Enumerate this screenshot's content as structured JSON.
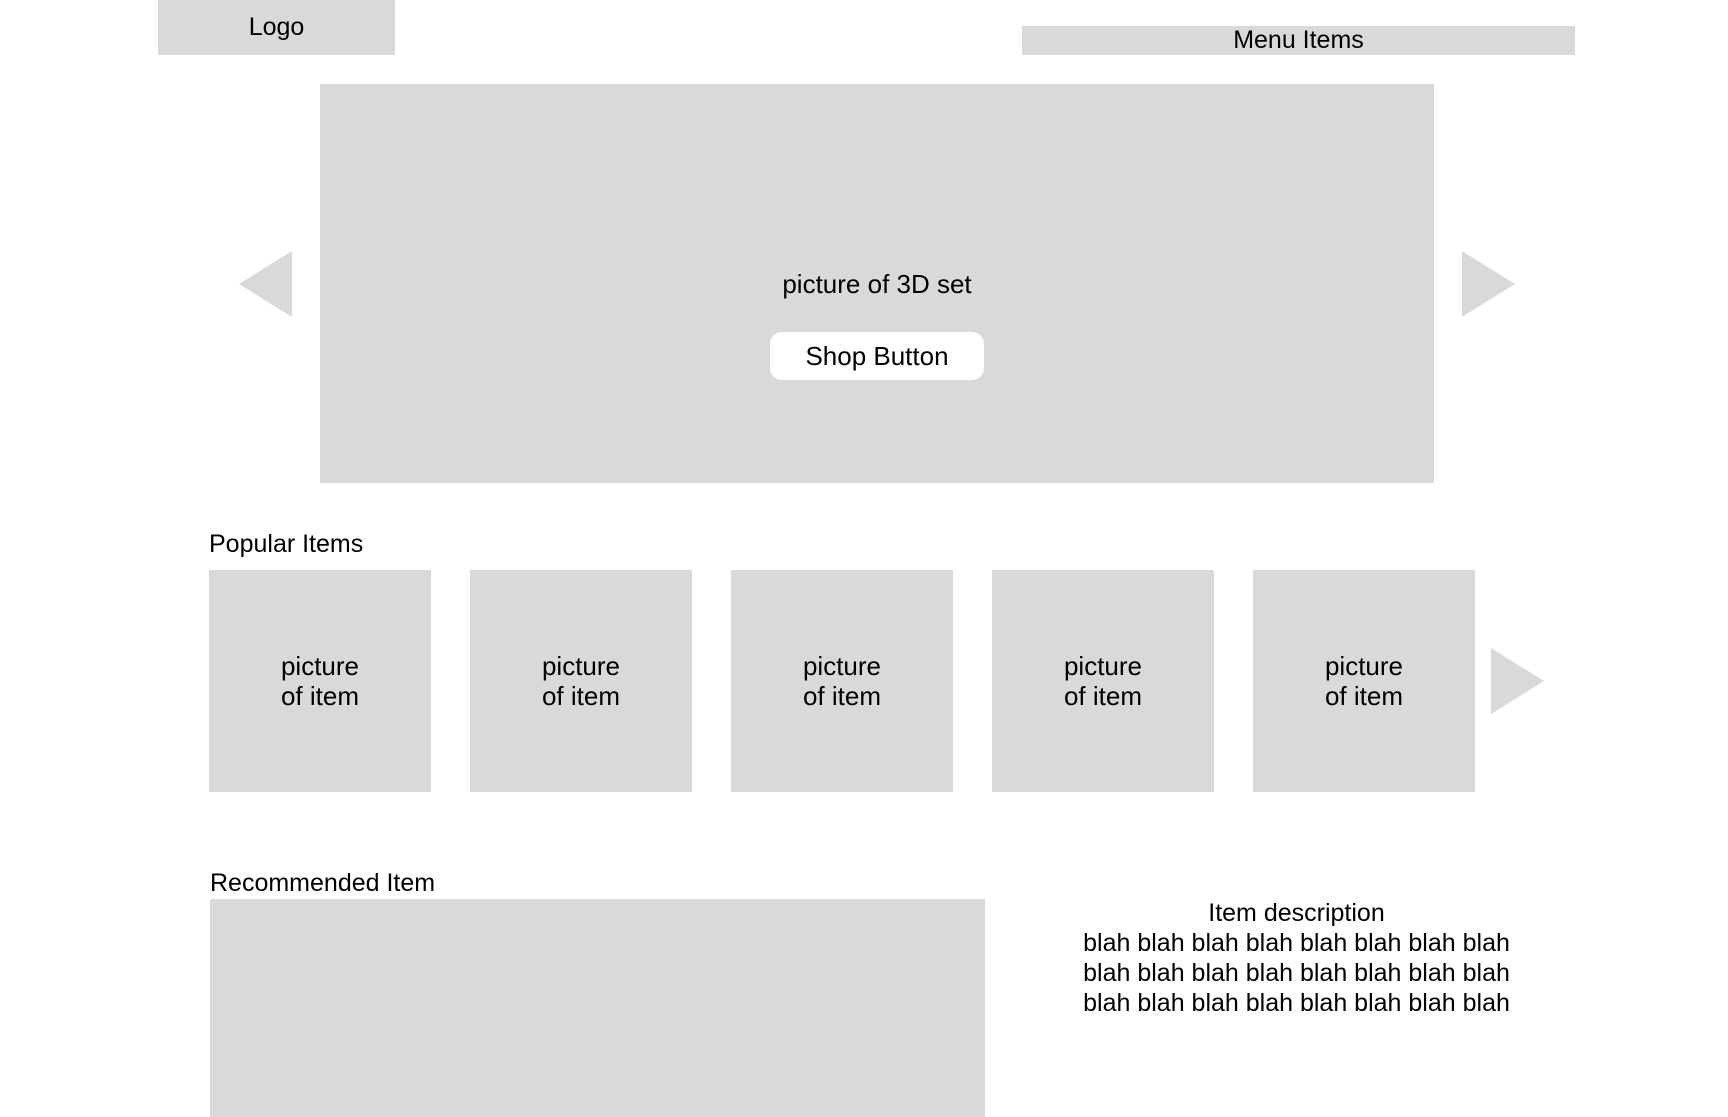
{
  "header": {
    "logo_label": "Logo",
    "menu_label": "Menu Items"
  },
  "hero": {
    "caption": "picture of 3D set",
    "shop_button_label": "Shop Button",
    "prev_icon": "triangle-left-icon",
    "next_icon": "triangle-right-icon"
  },
  "popular": {
    "heading": "Popular Items",
    "items": [
      {
        "line1": "picture",
        "line2": "of item"
      },
      {
        "line1": "picture",
        "line2": "of item"
      },
      {
        "line1": "picture",
        "line2": "of item"
      },
      {
        "line1": "picture",
        "line2": "of item"
      },
      {
        "line1": "picture",
        "line2": "of item"
      }
    ],
    "next_icon": "triangle-right-icon"
  },
  "recommended": {
    "heading": "Recommended Item",
    "description_title": "Item description",
    "description_lines": [
      "blah blah blah blah blah blah blah blah",
      "blah blah blah blah blah blah blah blah",
      "blah blah blah blah blah blah blah blah"
    ]
  },
  "colors": {
    "placeholder_gray": "#d9d9d9",
    "background": "#ffffff",
    "text": "#000000"
  }
}
